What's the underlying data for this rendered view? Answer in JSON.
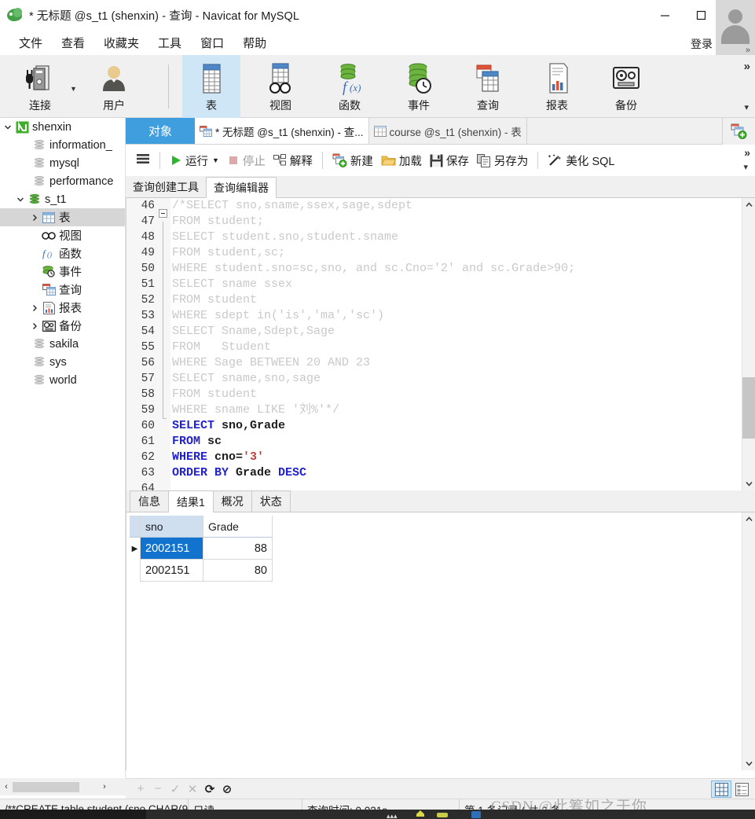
{
  "window": {
    "title": "* 无标题 @s_t1 (shenxin) - 查询 - Navicat for MySQL",
    "minimize_label": "—",
    "maximize_label": "□",
    "close_label": "✕"
  },
  "menubar": {
    "items": [
      {
        "label": "文件"
      },
      {
        "label": "查看"
      },
      {
        "label": "收藏夹"
      },
      {
        "label": "工具"
      },
      {
        "label": "窗口"
      },
      {
        "label": "帮助"
      }
    ],
    "login_label": "登录"
  },
  "toolbar": {
    "items": [
      {
        "label": "连接",
        "icon": "connection-icon",
        "selected": false,
        "has_caret": true
      },
      {
        "label": "用户",
        "icon": "user-icon",
        "selected": false,
        "has_caret": false
      },
      {
        "label": "表",
        "icon": "table-icon",
        "selected": true,
        "has_caret": false
      },
      {
        "label": "视图",
        "icon": "view-icon",
        "selected": false,
        "has_caret": false
      },
      {
        "label": "函数",
        "icon": "function-icon",
        "selected": false,
        "has_caret": false
      },
      {
        "label": "事件",
        "icon": "event-icon",
        "selected": false,
        "has_caret": false
      },
      {
        "label": "查询",
        "icon": "query-icon",
        "selected": false,
        "has_caret": false
      },
      {
        "label": "报表",
        "icon": "report-icon",
        "selected": false,
        "has_caret": false
      },
      {
        "label": "备份",
        "icon": "backup-icon",
        "selected": false,
        "has_caret": false
      }
    ],
    "overflow_label": "»",
    "overflow_caret": "▾"
  },
  "sidebar": {
    "items": [
      {
        "label": "shenxin",
        "depth": 0,
        "twisty": "down",
        "icon": "navicat-connection-icon",
        "selected": false
      },
      {
        "label": "information_",
        "depth": 1,
        "twisty": "none",
        "icon": "database-icon",
        "selected": false
      },
      {
        "label": "mysql",
        "depth": 1,
        "twisty": "none",
        "icon": "database-icon",
        "selected": false
      },
      {
        "label": "performance",
        "depth": 1,
        "twisty": "none",
        "icon": "database-icon",
        "selected": false
      },
      {
        "label": "s_t1",
        "depth": 1,
        "twisty": "down",
        "icon": "database-open-icon",
        "selected": false
      },
      {
        "label": "表",
        "depth": 2,
        "twisty": "right",
        "icon": "tables-folder-icon",
        "selected": true
      },
      {
        "label": "视图",
        "depth": 2,
        "twisty": "none",
        "icon": "views-icon",
        "selected": false
      },
      {
        "label": "函数",
        "depth": 2,
        "twisty": "none",
        "icon": "functions-icon",
        "selected": false
      },
      {
        "label": "事件",
        "depth": 2,
        "twisty": "none",
        "icon": "events-icon",
        "selected": false
      },
      {
        "label": "查询",
        "depth": 2,
        "twisty": "none",
        "icon": "queries-icon",
        "selected": false
      },
      {
        "label": "报表",
        "depth": 2,
        "twisty": "right",
        "icon": "reports-icon",
        "selected": false
      },
      {
        "label": "备份",
        "depth": 2,
        "twisty": "right",
        "icon": "backups-icon",
        "selected": false
      },
      {
        "label": "sakila",
        "depth": 1,
        "twisty": "none",
        "icon": "database-icon",
        "selected": false
      },
      {
        "label": "sys",
        "depth": 1,
        "twisty": "none",
        "icon": "database-icon",
        "selected": false
      },
      {
        "label": "world",
        "depth": 1,
        "twisty": "none",
        "icon": "database-icon",
        "selected": false
      }
    ],
    "hscroll": {
      "left_arrow": "‹",
      "right_arrow": "›"
    }
  },
  "tabstrip": {
    "object_tab": "对象",
    "tabs": [
      {
        "label": "* 无标题 @s_t1 (shenxin) - 查...",
        "icon": "query-tab-icon",
        "active": true
      },
      {
        "label": "course @s_t1 (shenxin) - 表",
        "icon": "table-tab-icon",
        "active": false
      }
    ],
    "add_tab_icon": "new-tab-icon"
  },
  "query_toolbar": {
    "menu_icon": "hamburger-icon",
    "buttons": [
      {
        "label": "运行",
        "icon": "run-icon",
        "disabled": false,
        "caret": true
      },
      {
        "label": "停止",
        "icon": "stop-icon",
        "disabled": true,
        "caret": false
      },
      {
        "label": "解释",
        "icon": "explain-icon",
        "disabled": false,
        "caret": false
      },
      {
        "label": "新建",
        "icon": "new-icon",
        "disabled": false,
        "caret": false
      },
      {
        "label": "加载",
        "icon": "load-icon",
        "disabled": false,
        "caret": false
      },
      {
        "label": "保存",
        "icon": "save-icon",
        "disabled": false,
        "caret": false
      },
      {
        "label": "另存为",
        "icon": "save-as-icon",
        "disabled": false,
        "caret": false
      },
      {
        "label": "美化 SQL",
        "icon": "beautify-icon",
        "disabled": false,
        "caret": false
      }
    ],
    "overflow_label": "»",
    "overflow_caret": "▾"
  },
  "editor_tabs": [
    {
      "label": "查询创建工具",
      "active": false
    },
    {
      "label": "查询编辑器",
      "active": true
    }
  ],
  "editor": {
    "first_line": 46,
    "lines": [
      {
        "n": 46,
        "fold": "start",
        "tokens": [
          {
            "t": "/*SELECT sno,sname,ssex,sage,sdept",
            "c": "cm"
          }
        ]
      },
      {
        "n": 47,
        "fold": "mid",
        "tokens": [
          {
            "t": "FROM student;",
            "c": "cm"
          }
        ]
      },
      {
        "n": 48,
        "fold": "mid",
        "tokens": [
          {
            "t": "SELECT student.sno,student.sname",
            "c": "cm"
          }
        ]
      },
      {
        "n": 49,
        "fold": "mid",
        "tokens": [
          {
            "t": "FROM student,sc;",
            "c": "cm"
          }
        ]
      },
      {
        "n": 50,
        "fold": "mid",
        "tokens": [
          {
            "t": "WHERE student.sno=sc,sno, and sc.Cno='2' and sc.Grade>90;",
            "c": "cm"
          }
        ]
      },
      {
        "n": 51,
        "fold": "mid",
        "tokens": [
          {
            "t": "SELECT sname ssex",
            "c": "cm"
          }
        ]
      },
      {
        "n": 52,
        "fold": "mid",
        "tokens": [
          {
            "t": "FROM student",
            "c": "cm"
          }
        ]
      },
      {
        "n": 53,
        "fold": "mid",
        "tokens": [
          {
            "t": "WHERE sdept in('is','ma','sc')",
            "c": "cm"
          }
        ]
      },
      {
        "n": 54,
        "fold": "mid",
        "tokens": [
          {
            "t": "SELECT Sname,Sdept,Sage",
            "c": "cm"
          }
        ]
      },
      {
        "n": 55,
        "fold": "mid",
        "tokens": [
          {
            "t": "FROM   Student",
            "c": "cm"
          }
        ]
      },
      {
        "n": 56,
        "fold": "mid",
        "tokens": [
          {
            "t": "WHERE Sage BETWEEN 20 AND 23",
            "c": "cm"
          }
        ]
      },
      {
        "n": 57,
        "fold": "mid",
        "tokens": [
          {
            "t": "SELECT sname,sno,sage",
            "c": "cm"
          }
        ]
      },
      {
        "n": 58,
        "fold": "mid",
        "tokens": [
          {
            "t": "FROM student",
            "c": "cm"
          }
        ]
      },
      {
        "n": 59,
        "fold": "end",
        "tokens": [
          {
            "t": "WHERE sname LIKE '刘%'*/",
            "c": "cm"
          }
        ]
      },
      {
        "n": 60,
        "fold": "none",
        "tokens": [
          {
            "t": "SELECT ",
            "c": "kw"
          },
          {
            "t": "sno,Grade",
            "c": "id"
          }
        ]
      },
      {
        "n": 61,
        "fold": "none",
        "tokens": [
          {
            "t": "FROM ",
            "c": "kw"
          },
          {
            "t": "sc",
            "c": "id"
          }
        ]
      },
      {
        "n": 62,
        "fold": "none",
        "tokens": [
          {
            "t": "WHERE ",
            "c": "kw"
          },
          {
            "t": "cno=",
            "c": "id"
          },
          {
            "t": "'3'",
            "c": "str"
          }
        ]
      },
      {
        "n": 63,
        "fold": "none",
        "tokens": [
          {
            "t": "ORDER BY ",
            "c": "kw"
          },
          {
            "t": "Grade ",
            "c": "id"
          },
          {
            "t": "DESC",
            "c": "kw"
          }
        ]
      },
      {
        "n": 64,
        "fold": "none",
        "tokens": [
          {
            "t": "",
            "c": "id"
          }
        ]
      }
    ],
    "scroll_up": "⌃",
    "scroll_down": "⌄"
  },
  "results": {
    "tabs": [
      {
        "label": "信息",
        "active": false
      },
      {
        "label": "结果1",
        "active": true
      },
      {
        "label": "概况",
        "active": false
      },
      {
        "label": "状态",
        "active": false
      }
    ],
    "columns": [
      "sno",
      "Grade"
    ],
    "rows": [
      {
        "cells": [
          "2002151",
          "88"
        ],
        "current": true
      },
      {
        "cells": [
          "2002151",
          "80"
        ],
        "current": false
      }
    ],
    "row_marker": "▶"
  },
  "edit_bar": {
    "buttons": [
      {
        "label": "+",
        "icon": "add-record-icon",
        "enabled": false
      },
      {
        "label": "−",
        "icon": "delete-record-icon",
        "enabled": false
      },
      {
        "label": "✓",
        "icon": "apply-change-icon",
        "enabled": false
      },
      {
        "label": "✕",
        "icon": "discard-change-icon",
        "enabled": false
      },
      {
        "label": "⟳",
        "icon": "refresh-icon",
        "enabled": true
      },
      {
        "label": "⊘",
        "icon": "stop-loading-icon",
        "enabled": true
      }
    ],
    "view_modes": [
      {
        "icon": "grid-view-icon",
        "selected": true
      },
      {
        "icon": "form-view-icon",
        "selected": false
      }
    ]
  },
  "statusbar": {
    "sql_preview": "/**CREATE table student (sno CHAR(9)",
    "readonly": "只读",
    "query_time": "查询时间: 0.021s",
    "record_info": "第 1 条记录 ( 共 2 条"
  },
  "watermark": {
    "text": "CSDN @此筹如之于你"
  },
  "colors": {
    "accent_blue": "#3e9ede",
    "selection_blue": "#1273ce",
    "toolbar_bg": "#f0f0f0",
    "ribbon_selected": "#cfe6f7",
    "keyword": "#2222cc",
    "string": "#c04040",
    "comment": "#c9c9c9"
  }
}
